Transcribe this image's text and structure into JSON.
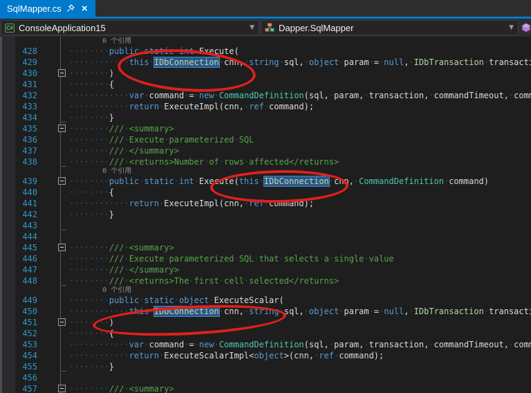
{
  "tab_bar": {
    "active_tab": {
      "title": "SqlMapper.cs"
    }
  },
  "nav_bar": {
    "project_dropdown": {
      "value": "ConsoleApplication15",
      "icon": "csharp-project-icon"
    },
    "type_dropdown": {
      "value": "Dapper.SqlMapper",
      "icon": "class-icon"
    },
    "member_dropdown_icon": "method-icon"
  },
  "colors": {
    "accent": "#007acc",
    "annotation_red": "#e0201c",
    "keyword": "#569cd6",
    "type": "#4ec9b0",
    "interface": "#b8d7a3",
    "comment": "#57a64a",
    "line_number": "#2f96c8",
    "highlight_bg": "#29588c"
  },
  "annotations": [
    {
      "shape": "ellipse",
      "around": "IDbConnection cnn parameter on line 429"
    },
    {
      "shape": "ellipse",
      "around": "this IDbConnection cnn parameter on line 439"
    },
    {
      "shape": "ellipse",
      "around": "this IDbConnection cnn parameter on line 450"
    }
  ],
  "editor": {
    "codelens_label": "0 个引用",
    "lines": [
      {
        "lens": true
      },
      {
        "num": 428,
        "fold": "",
        "segs": [
          [
            "pl",
            "        "
          ],
          [
            "kw",
            "public static int"
          ],
          [
            "pl",
            " Execute("
          ]
        ]
      },
      {
        "num": 429,
        "fold": "",
        "segs": [
          [
            "pl",
            "            "
          ],
          [
            "kw",
            "this"
          ],
          [
            "pl",
            " "
          ],
          [
            "hl",
            "IDbConnection"
          ],
          [
            "pl",
            " cnn, "
          ],
          [
            "kw",
            "string"
          ],
          [
            "pl",
            " sql, "
          ],
          [
            "kw",
            "object"
          ],
          [
            "pl",
            " param = "
          ],
          [
            "kw",
            "null"
          ],
          [
            "pl",
            ", "
          ],
          [
            "intf",
            "IDbTransaction"
          ],
          [
            "pl",
            " transaction"
          ]
        ]
      },
      {
        "num": 430,
        "fold": "box",
        "segs": [
          [
            "pl",
            "        )"
          ]
        ]
      },
      {
        "num": 431,
        "fold": "",
        "segs": [
          [
            "pl",
            "        {"
          ]
        ]
      },
      {
        "num": 432,
        "fold": "",
        "segs": [
          [
            "pl",
            "            "
          ],
          [
            "kw",
            "var"
          ],
          [
            "pl",
            " command = "
          ],
          [
            "kw",
            "new"
          ],
          [
            "pl",
            " "
          ],
          [
            "typ",
            "CommandDefinition"
          ],
          [
            "pl",
            "(sql, param, transaction, commandTimeout, commandType);"
          ]
        ]
      },
      {
        "num": 433,
        "fold": "",
        "segs": [
          [
            "pl",
            "            "
          ],
          [
            "kw",
            "return"
          ],
          [
            "pl",
            " ExecuteImpl(cnn, "
          ],
          [
            "kw",
            "ref"
          ],
          [
            "pl",
            " command);"
          ]
        ]
      },
      {
        "num": 434,
        "fold": "end",
        "segs": [
          [
            "pl",
            "        }"
          ]
        ]
      },
      {
        "num": 435,
        "fold": "box",
        "segs": [
          [
            "pl",
            "        "
          ],
          [
            "cmt",
            "/// <summary>"
          ]
        ]
      },
      {
        "num": 436,
        "fold": "",
        "segs": [
          [
            "pl",
            "        "
          ],
          [
            "cmt",
            "/// Execute parameterized SQL"
          ]
        ]
      },
      {
        "num": 437,
        "fold": "",
        "segs": [
          [
            "pl",
            "        "
          ],
          [
            "cmt",
            "/// </summary>"
          ]
        ]
      },
      {
        "num": 438,
        "fold": "end",
        "segs": [
          [
            "pl",
            "        "
          ],
          [
            "cmt",
            "/// <returns>Number of rows affected</returns>"
          ]
        ]
      },
      {
        "lens": true
      },
      {
        "num": 439,
        "fold": "box",
        "segs": [
          [
            "pl",
            "        "
          ],
          [
            "kw",
            "public static int"
          ],
          [
            "pl",
            " Execute("
          ],
          [
            "kw",
            "this"
          ],
          [
            "pl",
            " "
          ],
          [
            "hl",
            "IDbConnection"
          ],
          [
            "pl",
            " cnn, "
          ],
          [
            "typ",
            "CommandDefinition"
          ],
          [
            "pl",
            " command)"
          ]
        ]
      },
      {
        "num": 440,
        "fold": "",
        "segs": [
          [
            "pl",
            "        {"
          ]
        ]
      },
      {
        "num": 441,
        "fold": "",
        "segs": [
          [
            "pl",
            "            "
          ],
          [
            "kw",
            "return"
          ],
          [
            "pl",
            " ExecuteImpl(cnn, "
          ],
          [
            "kw",
            "ref"
          ],
          [
            "pl",
            " command);"
          ]
        ]
      },
      {
        "num": 442,
        "fold": "",
        "segs": [
          [
            "pl",
            "        }"
          ]
        ]
      },
      {
        "num": 443,
        "fold": "end",
        "segs": []
      },
      {
        "num": 444,
        "fold": "",
        "segs": []
      },
      {
        "num": 445,
        "fold": "box",
        "segs": [
          [
            "pl",
            "        "
          ],
          [
            "cmt",
            "/// <summary>"
          ]
        ]
      },
      {
        "num": 446,
        "fold": "",
        "segs": [
          [
            "pl",
            "        "
          ],
          [
            "cmt",
            "/// Execute parameterized SQL that selects a single value"
          ]
        ]
      },
      {
        "num": 447,
        "fold": "",
        "segs": [
          [
            "pl",
            "        "
          ],
          [
            "cmt",
            "/// </summary>"
          ]
        ]
      },
      {
        "num": 448,
        "fold": "end",
        "segs": [
          [
            "pl",
            "        "
          ],
          [
            "cmt",
            "/// <returns>The first cell selected</returns>"
          ]
        ]
      },
      {
        "lens": true
      },
      {
        "num": 449,
        "fold": "",
        "segs": [
          [
            "pl",
            "        "
          ],
          [
            "kw",
            "public static object"
          ],
          [
            "pl",
            " ExecuteScalar("
          ]
        ]
      },
      {
        "num": 450,
        "fold": "",
        "segs": [
          [
            "pl",
            "            "
          ],
          [
            "kw",
            "this"
          ],
          [
            "pl",
            " "
          ],
          [
            "hl",
            "IDbConnection"
          ],
          [
            "pl",
            " cnn, "
          ],
          [
            "kw",
            "string"
          ],
          [
            "pl",
            " sql, "
          ],
          [
            "kw",
            "object"
          ],
          [
            "pl",
            " param = "
          ],
          [
            "kw",
            "null"
          ],
          [
            "pl",
            ", "
          ],
          [
            "intf",
            "IDbTransaction"
          ],
          [
            "pl",
            " transaction"
          ]
        ]
      },
      {
        "num": 451,
        "fold": "box",
        "segs": [
          [
            "pl",
            "        )"
          ]
        ]
      },
      {
        "num": 452,
        "fold": "",
        "segs": [
          [
            "pl",
            "        {"
          ]
        ]
      },
      {
        "num": 453,
        "fold": "",
        "segs": [
          [
            "pl",
            "            "
          ],
          [
            "kw",
            "var"
          ],
          [
            "pl",
            " command = "
          ],
          [
            "kw",
            "new"
          ],
          [
            "pl",
            " "
          ],
          [
            "typ",
            "CommandDefinition"
          ],
          [
            "pl",
            "(sql, param, transaction, commandTimeout, commandType);"
          ]
        ]
      },
      {
        "num": 454,
        "fold": "",
        "segs": [
          [
            "pl",
            "            "
          ],
          [
            "kw",
            "return"
          ],
          [
            "pl",
            " ExecuteScalarImpl<"
          ],
          [
            "kw",
            "object"
          ],
          [
            "pl",
            ">(cnn, "
          ],
          [
            "kw",
            "ref"
          ],
          [
            "pl",
            " command);"
          ]
        ]
      },
      {
        "num": 455,
        "fold": "end",
        "segs": [
          [
            "pl",
            "        }"
          ]
        ]
      },
      {
        "num": 456,
        "fold": "",
        "segs": []
      },
      {
        "num": 457,
        "fold": "box",
        "segs": [
          [
            "pl",
            "        "
          ],
          [
            "cmt",
            "/// <summary>"
          ]
        ]
      }
    ]
  }
}
